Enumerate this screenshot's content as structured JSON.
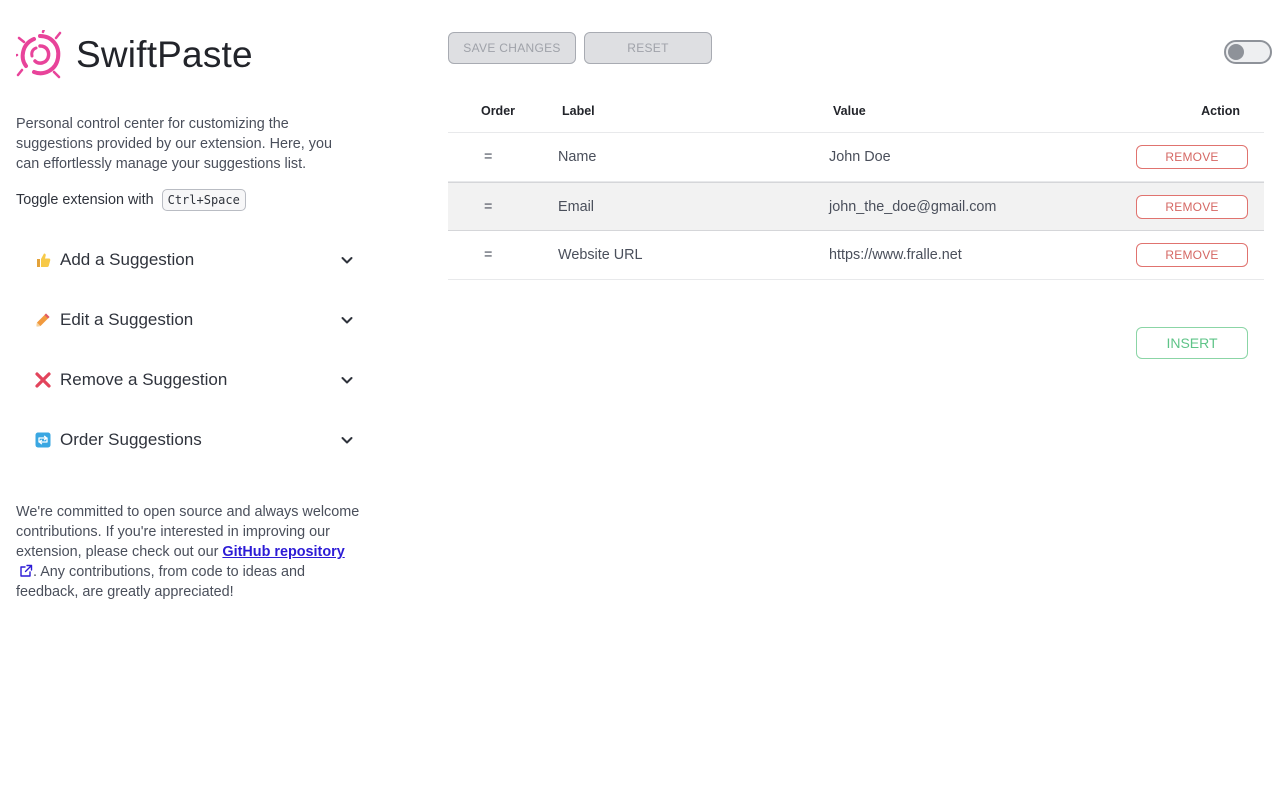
{
  "brand": {
    "name": "SwiftPaste",
    "logo_icon": "swirl-logo-icon",
    "logo_color": "#e8439a"
  },
  "intro": {
    "text": "Personal control center for customizing the suggestions provided by our extension. Here, you can effortlessly manage your suggestions list."
  },
  "shortcut": {
    "label": "Toggle extension with",
    "keys": "Ctrl+Space"
  },
  "accordion": [
    {
      "label": "Add a Suggestion",
      "icon": "thumbs-up-icon"
    },
    {
      "label": "Edit a Suggestion",
      "icon": "pencil-icon"
    },
    {
      "label": "Remove a Suggestion",
      "icon": "cross-mark-icon"
    },
    {
      "label": "Order Suggestions",
      "icon": "repeat-arrows-icon"
    }
  ],
  "footer": {
    "before": "We're committed to open source and always welcome contributions. If you're interested in improving our extension, please check out our ",
    "link": "GitHub repository",
    "after": ". Any contributions, from code to ideas and feedback, are greatly appreciated!"
  },
  "toolbar": {
    "save_label": "SAVE CHANGES",
    "reset_label": "RESET",
    "toggle_state": "off"
  },
  "table": {
    "headers": {
      "order": "Order",
      "label": "Label",
      "value": "Value",
      "action": "Action"
    },
    "rows": [
      {
        "order": "=",
        "label": "Name",
        "value": "John Doe",
        "action": "REMOVE"
      },
      {
        "order": "=",
        "label": "Email",
        "value": "john_the_doe@gmail.com",
        "action": "REMOVE"
      },
      {
        "order": "=",
        "label": "Website URL",
        "value": "https://www.fralle.net",
        "action": "REMOVE"
      }
    ]
  },
  "insert_label": "INSERT",
  "colors": {
    "remove": "#d56763",
    "insert": "#5fc488",
    "link": "#2c1bd6"
  }
}
